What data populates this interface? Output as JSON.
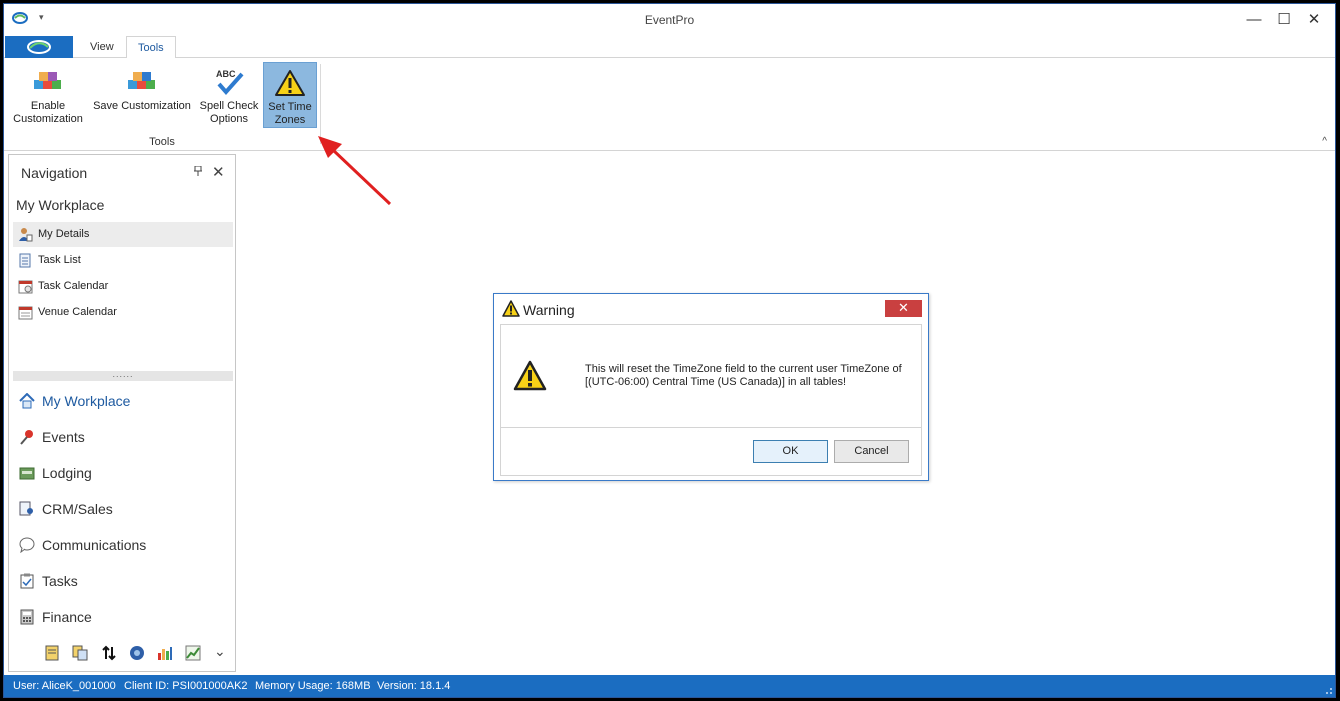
{
  "window": {
    "title": "EventPro"
  },
  "qat": {
    "dropdown": "▾"
  },
  "controls": {
    "minimize": "—",
    "maximize": "☐",
    "close": "✕"
  },
  "tabs": [
    {
      "label": "View",
      "active": false
    },
    {
      "label": "Tools",
      "active": true
    }
  ],
  "ribbon": {
    "buttons": [
      {
        "label": "Enable Customization",
        "icon": "customization-cubes-icon"
      },
      {
        "label": "Save Customization",
        "icon": "save-customization-icon"
      },
      {
        "label": "Spell Check Options",
        "icon": "spell-check-icon"
      },
      {
        "label": "Set Time Zones",
        "icon": "warning-icon",
        "selected": true
      }
    ],
    "group_label": "Tools",
    "collapse": "^"
  },
  "navigation": {
    "header": "Navigation",
    "pin": "📌",
    "close": "✕",
    "group_title": "My Workplace",
    "items": [
      {
        "label": "My Details",
        "icon": "user-details-icon",
        "selected": true
      },
      {
        "label": "Task List",
        "icon": "task-list-icon"
      },
      {
        "label": "Task Calendar",
        "icon": "task-calendar-icon"
      },
      {
        "label": "Venue Calendar",
        "icon": "venue-calendar-icon"
      }
    ],
    "splitter": "......",
    "modules": [
      {
        "label": "My Workplace",
        "icon": "home-icon",
        "active": true
      },
      {
        "label": "Events",
        "icon": "pushpin-icon"
      },
      {
        "label": "Lodging",
        "icon": "lodging-icon"
      },
      {
        "label": "CRM/Sales",
        "icon": "crm-icon"
      },
      {
        "label": "Communications",
        "icon": "speech-bubble-icon"
      },
      {
        "label": "Tasks",
        "icon": "clipboard-icon"
      },
      {
        "label": "Finance",
        "icon": "calculator-icon"
      }
    ],
    "more": "⌄"
  },
  "status": {
    "user": "User: AliceK_001000",
    "client": "Client ID: PSI001000AK2",
    "memory": "Memory Usage: 168MB",
    "version": "Version: 18.1.4"
  },
  "dialog": {
    "title": "Warning",
    "close": "✕",
    "message_line1": "This will reset the TimeZone field to the current user TimeZone of",
    "message_line2": "[(UTC-06:00) Central Time (US  Canada)] in all tables!",
    "ok": "OK",
    "cancel": "Cancel"
  },
  "colors": {
    "accent": "#1b6dc1",
    "selected_button": "#8cb8df",
    "dialog_close": "#c94040",
    "annotation_arrow": "#e02020"
  }
}
